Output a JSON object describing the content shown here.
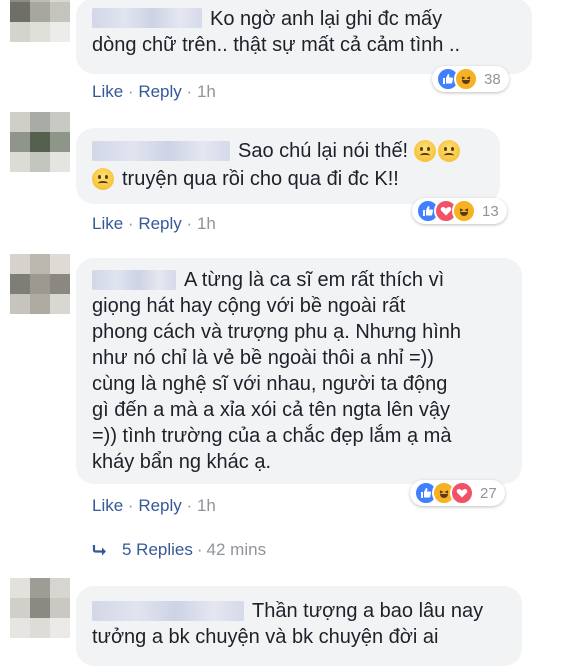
{
  "comments": [
    {
      "text": "Ko ngờ anh lại ghi đc mấy\ndòng chữ trên.. thật sự mất cả cảm tình ..",
      "like": "Like",
      "dot": "·",
      "reply": "Reply",
      "time": "1h",
      "reaction_count": "38",
      "reactions": [
        "like-icon",
        "haha-icon"
      ]
    },
    {
      "text_line1": "Sao chú lại nói thế!",
      "text_line2": "truyện qua rồi cho qua đi đc K!!",
      "like": "Like",
      "dot": "·",
      "reply": "Reply",
      "time": "1h",
      "reaction_count": "13",
      "reactions": [
        "like-icon",
        "love-icon",
        "haha-icon"
      ]
    },
    {
      "text": "A từng là ca sĩ em rất thích vì\ngiọng hát hay cộng với bề ngoài rất\nphong cách và trượng phu ạ. Nhưng hình\nnhư nó chỉ là vẻ bề ngoài thôi a nhỉ =))\ncùng là nghệ sĩ với nhau, người ta động\ngì đến a mà a xỉa xói cả tên ngta lên vậy\n=)) tình trường của a chắc đẹp lắm ạ mà\nkháy bẩn ng khác ạ.",
      "like": "Like",
      "dot": "·",
      "reply": "Reply",
      "time": "1h",
      "reaction_count": "27",
      "reactions": [
        "like-icon",
        "haha-icon",
        "love-icon"
      ]
    },
    {
      "text": "Thần tượng a bao lâu nay\ntưởng a bk chuyện và bk chuyện đời ai"
    }
  ],
  "replies_link": {
    "label": "5 Replies",
    "dot": "·",
    "time": "42 mins"
  },
  "colors": {
    "like": "#365899",
    "bubble": "#f2f3f5",
    "like_icon": "#4080ff",
    "love_icon": "#f25268",
    "haha_icon": "#f7b125"
  }
}
